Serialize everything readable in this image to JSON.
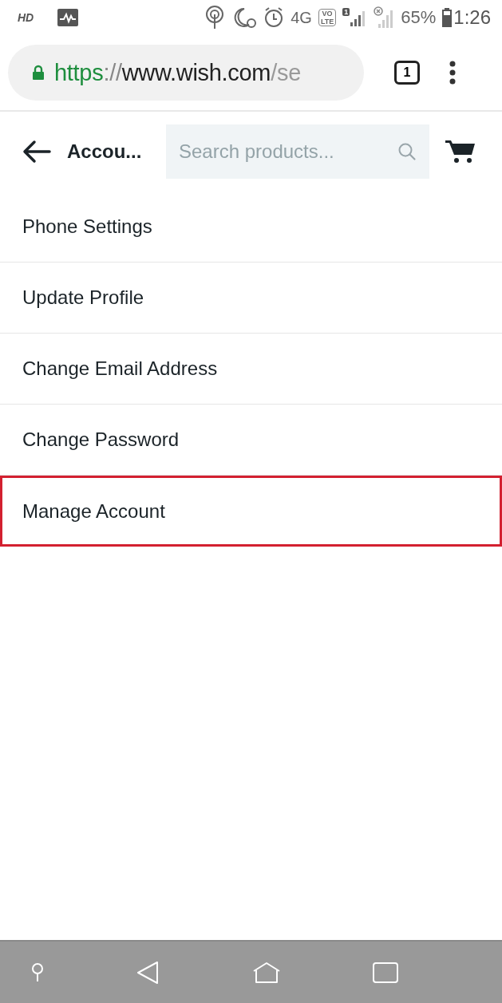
{
  "status_bar": {
    "hd": "HD",
    "network": "4G",
    "volte": "VO",
    "volte_sub": "LTE",
    "sim_badge": "1",
    "battery": "65%",
    "time": "1:26"
  },
  "address_bar": {
    "scheme": "https",
    "separator": "://",
    "host": "www.wish.com",
    "path": "/se",
    "tab_count": "1"
  },
  "header": {
    "title": "Accou...",
    "search": {
      "placeholder": "Search products..."
    }
  },
  "menu": [
    {
      "label": "Phone Settings",
      "highlighted": false
    },
    {
      "label": "Update Profile",
      "highlighted": false
    },
    {
      "label": "Change Email Address",
      "highlighted": false
    },
    {
      "label": "Change Password",
      "highlighted": false
    },
    {
      "label": "Manage Account",
      "highlighted": true
    }
  ]
}
